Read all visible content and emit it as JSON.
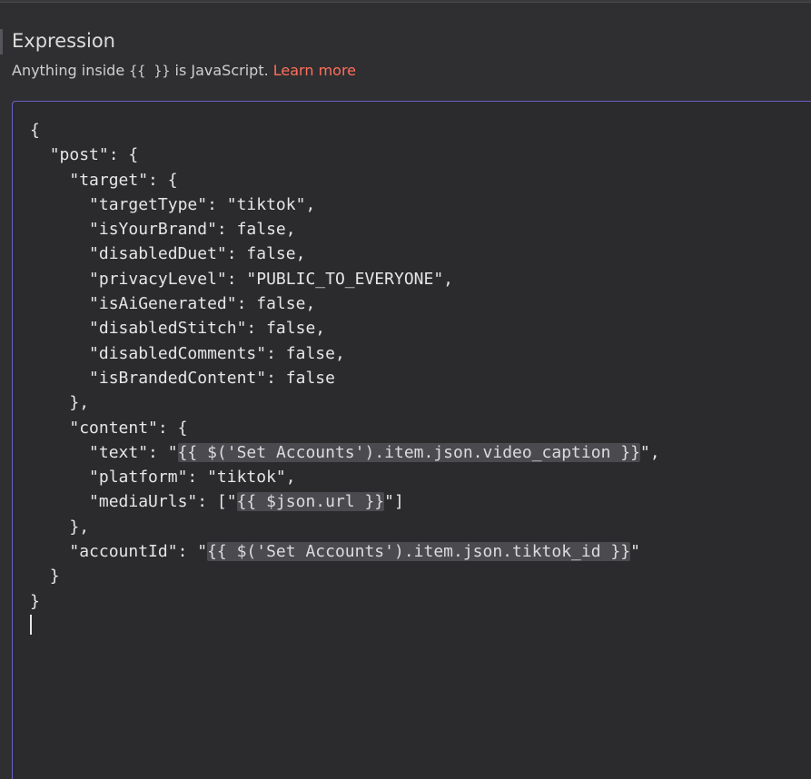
{
  "panel": {
    "title": "Expression",
    "hint_before": "Anything inside",
    "hint_braces": "{{ }}",
    "hint_after": "is JavaScript.",
    "learn_more": "Learn more"
  },
  "editor": {
    "lines": [
      {
        "indent": 0,
        "parts": [
          {
            "t": "{"
          }
        ]
      },
      {
        "indent": 1,
        "parts": [
          {
            "t": "\"post\": {"
          }
        ]
      },
      {
        "indent": 2,
        "parts": [
          {
            "t": "\"target\": {"
          }
        ]
      },
      {
        "indent": 3,
        "parts": [
          {
            "t": "\"targetType\": \"tiktok\","
          }
        ]
      },
      {
        "indent": 3,
        "parts": [
          {
            "t": "\"isYourBrand\": false,"
          }
        ]
      },
      {
        "indent": 3,
        "parts": [
          {
            "t": "\"disabledDuet\": false,"
          }
        ]
      },
      {
        "indent": 3,
        "parts": [
          {
            "t": "\"privacyLevel\": \"PUBLIC_TO_EVERYONE\","
          }
        ]
      },
      {
        "indent": 3,
        "parts": [
          {
            "t": "\"isAiGenerated\": false,"
          }
        ]
      },
      {
        "indent": 3,
        "parts": [
          {
            "t": "\"disabledStitch\": false,"
          }
        ]
      },
      {
        "indent": 3,
        "parts": [
          {
            "t": "\"disabledComments\": false,"
          }
        ]
      },
      {
        "indent": 3,
        "parts": [
          {
            "t": "\"isBrandedContent\": false"
          }
        ]
      },
      {
        "indent": 2,
        "parts": [
          {
            "t": "},"
          }
        ]
      },
      {
        "indent": 2,
        "parts": [
          {
            "t": "\"content\": {"
          }
        ]
      },
      {
        "indent": 3,
        "parts": [
          {
            "t": "\"text\": \""
          },
          {
            "t": "{{ $('Set Accounts').item.json.video_caption }}",
            "expr": true
          },
          {
            "t": "\","
          }
        ]
      },
      {
        "indent": 3,
        "parts": [
          {
            "t": "\"platform\": \"tiktok\","
          }
        ]
      },
      {
        "indent": 3,
        "parts": [
          {
            "t": "\"mediaUrls\": [\""
          },
          {
            "t": "{{ $json.url }}",
            "expr": true
          },
          {
            "t": "\"]"
          }
        ]
      },
      {
        "indent": 2,
        "parts": [
          {
            "t": "},"
          }
        ]
      },
      {
        "indent": 2,
        "parts": [
          {
            "t": "\"accountId\": \""
          },
          {
            "t": "{{ $('Set Accounts').item.json.tiktok_id }}",
            "expr": true
          },
          {
            "t": "\""
          }
        ]
      },
      {
        "indent": 1,
        "parts": [
          {
            "t": "}"
          }
        ]
      },
      {
        "indent": 0,
        "parts": [
          {
            "t": "}"
          }
        ]
      },
      {
        "indent": 0,
        "parts": [],
        "cursor": true
      }
    ]
  }
}
